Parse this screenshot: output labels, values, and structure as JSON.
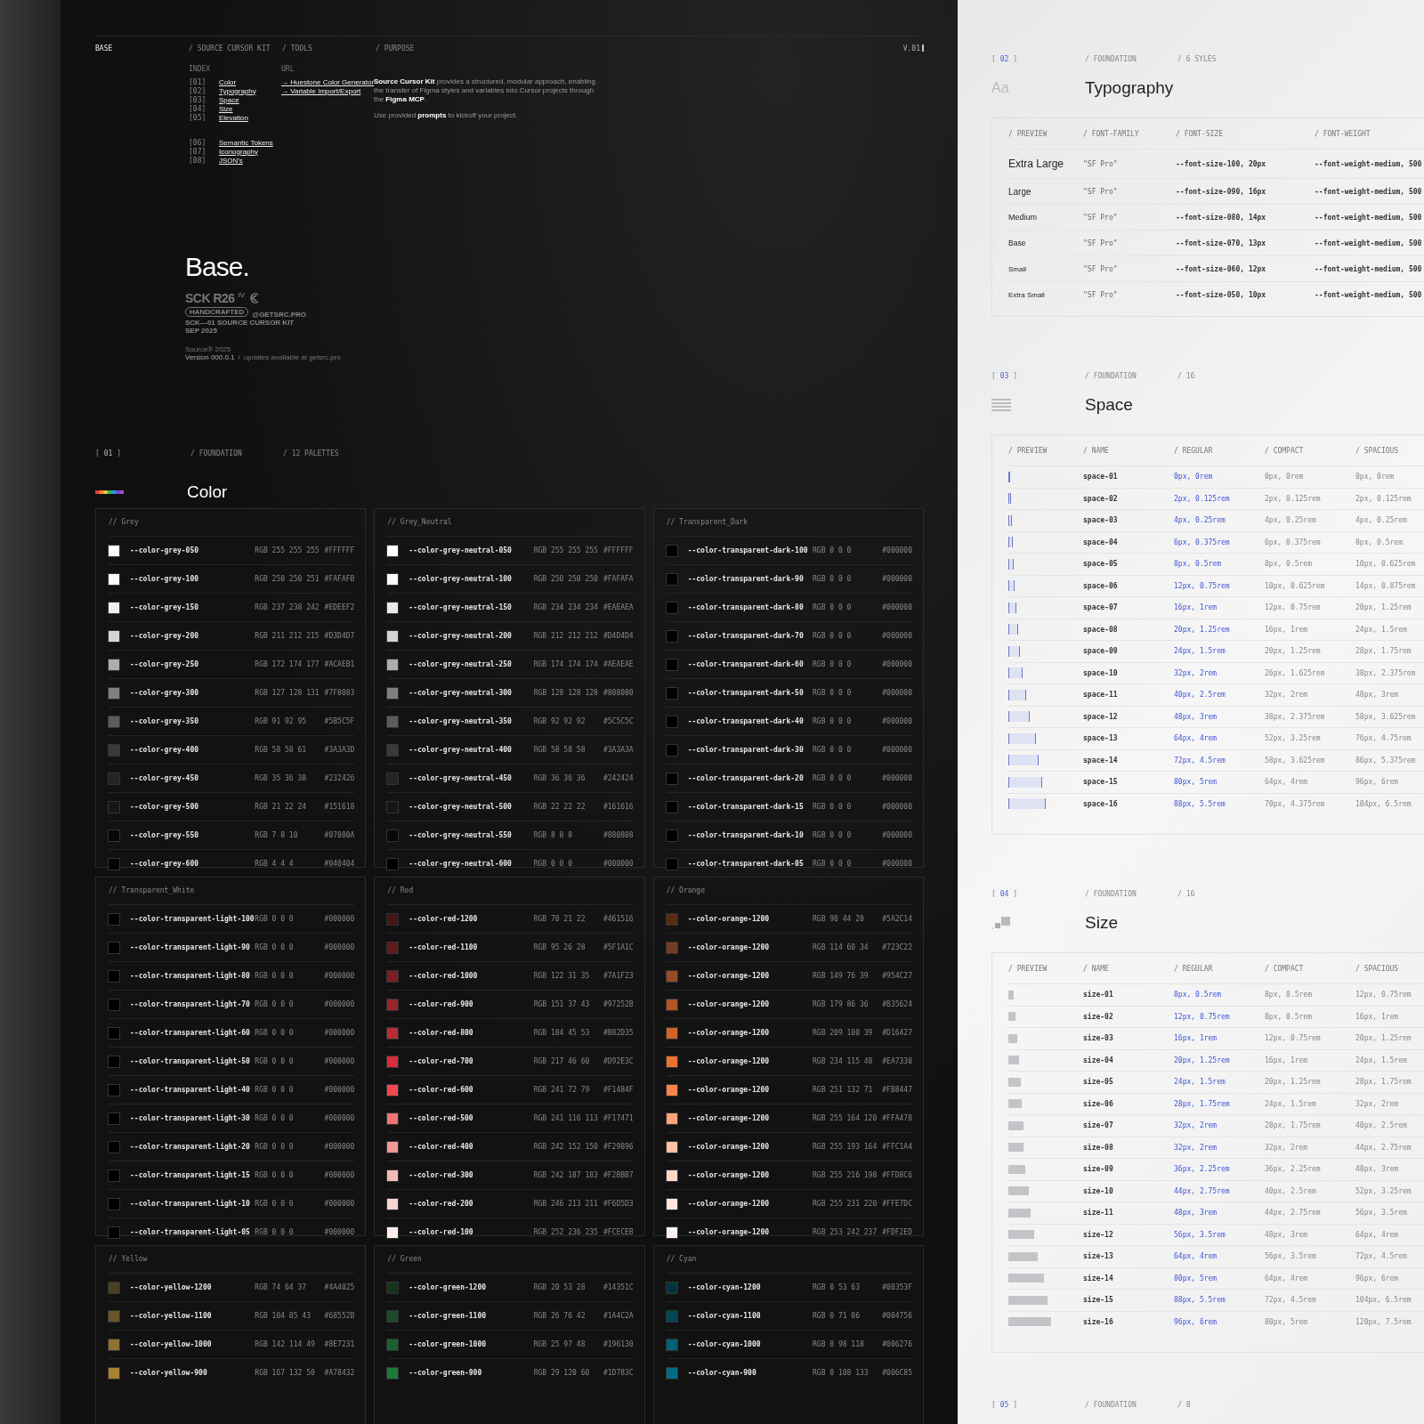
{
  "header": [
    {
      "label": "BASE",
      "selected": true
    },
    {
      "label": "/ SOURCE CURSOR KIT",
      "selected": false
    },
    {
      "label": "/ TOOLS",
      "selected": false
    },
    {
      "label": "/ PURPOSE",
      "selected": false
    }
  ],
  "version": "V.01",
  "index": {
    "label": "INDEX",
    "groups": [
      [
        {
          "num": "[01]",
          "label": "Color"
        },
        {
          "num": "[02]",
          "label": "Typography"
        },
        {
          "num": "[03]",
          "label": "Space"
        },
        {
          "num": "[04]",
          "label": "Size"
        },
        {
          "num": "[05]",
          "label": "Elevation"
        }
      ],
      [
        {
          "num": "[06]",
          "label": "Semantic Tokens"
        },
        {
          "num": "[07]",
          "label": "Iconography"
        },
        {
          "num": "[08]",
          "label": "JSON's"
        }
      ]
    ]
  },
  "tools": {
    "label": "URL",
    "links": [
      "→ Huestone Color Generator",
      "→ Variable Import/Export"
    ]
  },
  "purpose": [
    "**Source Cursor Kit** provides a structured, modular approach, enabling the transfer of Figma styles and variables into Cursor projects through the **Figma MCP**.",
    "Use provided **prompts** to kickoff your project."
  ],
  "hero": {
    "title": "Base.",
    "logo": "SCK R26",
    "logo_mark": "IV",
    "pill": "HANDCRAFTED",
    "handle": "@GETSRC.PRO",
    "kit": "SCK—01 SOURCE CURSOR KIT",
    "date": "SEP 2025",
    "copyright": "Source® 2025",
    "version": "Version 000.0.1",
    "separator": "/",
    "updates": "updates available at getsrc.pro"
  },
  "color_section": {
    "open": "[",
    "number": "01",
    "close": "]",
    "tags": [
      "/ FOUNDATION",
      "/ 12 PALETTES"
    ],
    "title": "Color",
    "palettes": [
      {
        "name": "// Grey",
        "swatches": [
          {
            "name": "--color-grey-050",
            "rgb": "RGB 255 255 255",
            "hex": "#FFFFFF",
            "color": "#ffffff"
          },
          {
            "name": "--color-grey-100",
            "rgb": "RGB 250 250 251",
            "hex": "#FAFAFB",
            "color": "#fafafb"
          },
          {
            "name": "--color-grey-150",
            "rgb": "RGB 237 238 242",
            "hex": "#EDEEF2",
            "color": "#edeef2"
          },
          {
            "name": "--color-grey-200",
            "rgb": "RGB 211 212 215",
            "hex": "#D3D4D7",
            "color": "#d3d4d7"
          },
          {
            "name": "--color-grey-250",
            "rgb": "RGB 172 174 177",
            "hex": "#ACAEB1",
            "color": "#acaeb1"
          },
          {
            "name": "--color-grey-300",
            "rgb": "RGB 127 128 131",
            "hex": "#7F8083",
            "color": "#7f8083"
          },
          {
            "name": "--color-grey-350",
            "rgb": "RGB 91 92 95",
            "hex": "#5B5C5F",
            "color": "#5b5c5f"
          },
          {
            "name": "--color-grey-400",
            "rgb": "RGB 58 58 61",
            "hex": "#3A3A3D",
            "color": "#3a3a3d"
          },
          {
            "name": "--color-grey-450",
            "rgb": "RGB 35 36 38",
            "hex": "#232426",
            "color": "#232426"
          },
          {
            "name": "--color-grey-500",
            "rgb": "RGB 21 22 24",
            "hex": "#151618",
            "color": "#151618"
          },
          {
            "name": "--color-grey-550",
            "rgb": "RGB 7 8 10",
            "hex": "#07080A",
            "color": "#07080a"
          },
          {
            "name": "--color-grey-600",
            "rgb": "RGB 4 4 4",
            "hex": "#040404",
            "color": "#040404"
          }
        ]
      },
      {
        "name": "// Grey_Neutral",
        "swatches": [
          {
            "name": "--color-grey-neutral-050",
            "rgb": "RGB 255 255 255",
            "hex": "#FFFFFF",
            "color": "#ffffff"
          },
          {
            "name": "--color-grey-neutral-100",
            "rgb": "RGB 250 250 250",
            "hex": "#FAFAFA",
            "color": "#fafafa"
          },
          {
            "name": "--color-grey-neutral-150",
            "rgb": "RGB 234 234 234",
            "hex": "#EAEAEA",
            "color": "#eaeaea"
          },
          {
            "name": "--color-grey-neutral-200",
            "rgb": "RGB 212 212 212",
            "hex": "#D4D4D4",
            "color": "#d4d4d4"
          },
          {
            "name": "--color-grey-neutral-250",
            "rgb": "RGB 174 174 174",
            "hex": "#AEAEAE",
            "color": "#aeaeae"
          },
          {
            "name": "--color-grey-neutral-300",
            "rgb": "RGB 128 128 128",
            "hex": "#808080",
            "color": "#808080"
          },
          {
            "name": "--color-grey-neutral-350",
            "rgb": "RGB 92 92 92",
            "hex": "#5C5C5C",
            "color": "#5c5c5c"
          },
          {
            "name": "--color-grey-neutral-400",
            "rgb": "RGB 58 58 58",
            "hex": "#3A3A3A",
            "color": "#3a3a3a"
          },
          {
            "name": "--color-grey-neutral-450",
            "rgb": "RGB 36 36 36",
            "hex": "#242424",
            "color": "#242424"
          },
          {
            "name": "--color-grey-neutral-500",
            "rgb": "RGB 22 22 22",
            "hex": "#161616",
            "color": "#161616"
          },
          {
            "name": "--color-grey-neutral-550",
            "rgb": "RGB 8 8 8",
            "hex": "#080808",
            "color": "#080808"
          },
          {
            "name": "--color-grey-neutral-600",
            "rgb": "RGB 0 0 0",
            "hex": "#000000",
            "color": "#000000"
          }
        ]
      },
      {
        "name": "// Transparent_Dark",
        "swatches": [
          {
            "name": "--color-transparent-dark-100",
            "rgb": "RGB 0 0 0",
            "hex": "#000000",
            "color": "#000000"
          },
          {
            "name": "--color-transparent-dark-90",
            "rgb": "RGB 0 0 0",
            "hex": "#000000",
            "color": "#000000"
          },
          {
            "name": "--color-transparent-dark-80",
            "rgb": "RGB 0 0 0",
            "hex": "#000000",
            "color": "#000000"
          },
          {
            "name": "--color-transparent-dark-70",
            "rgb": "RGB 0 0 0",
            "hex": "#000000",
            "color": "#000000"
          },
          {
            "name": "--color-transparent-dark-60",
            "rgb": "RGB 0 0 0",
            "hex": "#000000",
            "color": "#000000"
          },
          {
            "name": "--color-transparent-dark-50",
            "rgb": "RGB 0 0 0",
            "hex": "#000000",
            "color": "#000000"
          },
          {
            "name": "--color-transparent-dark-40",
            "rgb": "RGB 0 0 0",
            "hex": "#000000",
            "color": "#000000"
          },
          {
            "name": "--color-transparent-dark-30",
            "rgb": "RGB 0 0 0",
            "hex": "#000000",
            "color": "#000000"
          },
          {
            "name": "--color-transparent-dark-20",
            "rgb": "RGB 0 0 0",
            "hex": "#000000",
            "color": "#000000"
          },
          {
            "name": "--color-transparent-dark-15",
            "rgb": "RGB 0 0 0",
            "hex": "#000000",
            "color": "#000000"
          },
          {
            "name": "--color-transparent-dark-10",
            "rgb": "RGB 0 0 0",
            "hex": "#000000",
            "color": "#000000"
          },
          {
            "name": "--color-transparent-dark-05",
            "rgb": "RGB 0 0 0",
            "hex": "#000000",
            "color": "#000000"
          }
        ]
      },
      {
        "name": "// Transparent_White",
        "swatches": [
          {
            "name": "--color-transparent-light-100",
            "rgb": "RGB 0 0 0",
            "hex": "#000000",
            "color": "#000000"
          },
          {
            "name": "--color-transparent-light-90",
            "rgb": "RGB 0 0 0",
            "hex": "#000000",
            "color": "#000000"
          },
          {
            "name": "--color-transparent-light-80",
            "rgb": "RGB 0 0 0",
            "hex": "#000000",
            "color": "#000000"
          },
          {
            "name": "--color-transparent-light-70",
            "rgb": "RGB 0 0 0",
            "hex": "#000000",
            "color": "#000000"
          },
          {
            "name": "--color-transparent-light-60",
            "rgb": "RGB 0 0 0",
            "hex": "#000000",
            "color": "#000000"
          },
          {
            "name": "--color-transparent-light-50",
            "rgb": "RGB 0 0 0",
            "hex": "#000000",
            "color": "#000000"
          },
          {
            "name": "--color-transparent-light-40",
            "rgb": "RGB 0 0 0",
            "hex": "#000000",
            "color": "#000000"
          },
          {
            "name": "--color-transparent-light-30",
            "rgb": "RGB 0 0 0",
            "hex": "#000000",
            "color": "#000000"
          },
          {
            "name": "--color-transparent-light-20",
            "rgb": "RGB 0 0 0",
            "hex": "#000000",
            "color": "#000000"
          },
          {
            "name": "--color-transparent-light-15",
            "rgb": "RGB 0 0 0",
            "hex": "#000000",
            "color": "#000000"
          },
          {
            "name": "--color-transparent-light-10",
            "rgb": "RGB 0 0 0",
            "hex": "#000000",
            "color": "#000000"
          },
          {
            "name": "--color-transparent-light-05",
            "rgb": "RGB 0 0 0",
            "hex": "#000000",
            "color": "#000000"
          }
        ]
      },
      {
        "name": "// Red",
        "swatches": [
          {
            "name": "--color-red-1200",
            "rgb": "RGB 70 21 22",
            "hex": "#461516",
            "color": "#461516"
          },
          {
            "name": "--color-red-1100",
            "rgb": "RGB 95 26 28",
            "hex": "#5F1A1C",
            "color": "#5f1a1c"
          },
          {
            "name": "--color-red-1000",
            "rgb": "RGB 122 31 35",
            "hex": "#7A1F23",
            "color": "#7a1f23"
          },
          {
            "name": "--color-red-900",
            "rgb": "RGB 151 37 43",
            "hex": "#97252B",
            "color": "#97252b"
          },
          {
            "name": "--color-red-800",
            "rgb": "RGB 184 45 53",
            "hex": "#B82D35",
            "color": "#b82d35"
          },
          {
            "name": "--color-red-700",
            "rgb": "RGB 217 46 60",
            "hex": "#D92E3C",
            "color": "#d92e3c"
          },
          {
            "name": "--color-red-600",
            "rgb": "RGB 241 72 79",
            "hex": "#F1484F",
            "color": "#f1484f"
          },
          {
            "name": "--color-red-500",
            "rgb": "RGB 241 116 113",
            "hex": "#F17471",
            "color": "#f17471"
          },
          {
            "name": "--color-red-400",
            "rgb": "RGB 242 152 150",
            "hex": "#F29896",
            "color": "#f29896"
          },
          {
            "name": "--color-red-300",
            "rgb": "RGB 242 187 183",
            "hex": "#F2BBB7",
            "color": "#f2bbb7"
          },
          {
            "name": "--color-red-200",
            "rgb": "RGB 246 213 211",
            "hex": "#F6D5D3",
            "color": "#f6d5d3"
          },
          {
            "name": "--color-red-100",
            "rgb": "RGB 252 236 235",
            "hex": "#FCECEB",
            "color": "#fceceb"
          }
        ]
      },
      {
        "name": "// Orange",
        "swatches": [
          {
            "name": "--color-orange-1200",
            "rgb": "RGB 90 44 20",
            "hex": "#5A2C14",
            "color": "#5a2c14"
          },
          {
            "name": "--color-orange-1200",
            "rgb": "RGB 114 60 34",
            "hex": "#723C22",
            "color": "#723c22"
          },
          {
            "name": "--color-orange-1200",
            "rgb": "RGB 149 76 39",
            "hex": "#954C27",
            "color": "#954c27"
          },
          {
            "name": "--color-orange-1200",
            "rgb": "RGB 179 86 36",
            "hex": "#B35624",
            "color": "#b35624"
          },
          {
            "name": "--color-orange-1200",
            "rgb": "RGB 209 100 39",
            "hex": "#D16427",
            "color": "#d16427"
          },
          {
            "name": "--color-orange-1200",
            "rgb": "RGB 234 115 48",
            "hex": "#EA7330",
            "color": "#ea7330"
          },
          {
            "name": "--color-orange-1200",
            "rgb": "RGB 251 132 71",
            "hex": "#FB8447",
            "color": "#fb8447"
          },
          {
            "name": "--color-orange-1200",
            "rgb": "RGB 255 164 120",
            "hex": "#FFA478",
            "color": "#ffa478"
          },
          {
            "name": "--color-orange-1200",
            "rgb": "RGB 255 193 164",
            "hex": "#FFC1A4",
            "color": "#ffc1a4"
          },
          {
            "name": "--color-orange-1200",
            "rgb": "RGB 255 216 198",
            "hex": "#FFD8C6",
            "color": "#ffd8c6"
          },
          {
            "name": "--color-orange-1200",
            "rgb": "RGB 255 231 220",
            "hex": "#FFE7DC",
            "color": "#ffe7dc"
          },
          {
            "name": "--color-orange-1200",
            "rgb": "RGB 253 242 237",
            "hex": "#FDF2ED",
            "color": "#fdf2ed"
          }
        ]
      },
      {
        "name": "// Yellow",
        "swatches": [
          {
            "name": "--color-yellow-1200",
            "rgb": "RGB 74 64 37",
            "hex": "#4A4025",
            "color": "#4a4025"
          },
          {
            "name": "--color-yellow-1100",
            "rgb": "RGB 104 85 43",
            "hex": "#68552B",
            "color": "#68552b"
          },
          {
            "name": "--color-yellow-1000",
            "rgb": "RGB 142 114 49",
            "hex": "#8E7231",
            "color": "#8e7231"
          },
          {
            "name": "--color-yellow-900",
            "rgb": "RGB 167 132 50",
            "hex": "#A78432",
            "color": "#a78432"
          }
        ]
      },
      {
        "name": "// Green",
        "swatches": [
          {
            "name": "--color-green-1200",
            "rgb": "RGB 20 53 28",
            "hex": "#14351C",
            "color": "#14351c"
          },
          {
            "name": "--color-green-1100",
            "rgb": "RGB 26 76 42",
            "hex": "#1A4C2A",
            "color": "#1a4c2a"
          },
          {
            "name": "--color-green-1000",
            "rgb": "RGB 25 97 48",
            "hex": "#196130",
            "color": "#196130"
          },
          {
            "name": "--color-green-900",
            "rgb": "RGB 29 120 60",
            "hex": "#1D783C",
            "color": "#1d783c"
          }
        ]
      },
      {
        "name": "// Cyan",
        "swatches": [
          {
            "name": "--color-cyan-1200",
            "rgb": "RGB 0 53 63",
            "hex": "#00353F",
            "color": "#00353f"
          },
          {
            "name": "--color-cyan-1100",
            "rgb": "RGB 0 71 86",
            "hex": "#004756",
            "color": "#004756"
          },
          {
            "name": "--color-cyan-1000",
            "rgb": "RGB 0 98 118",
            "hex": "#006276",
            "color": "#006276"
          },
          {
            "name": "--color-cyan-900",
            "rgb": "RGB 0 108 133",
            "hex": "#006C85",
            "color": "#006c85"
          }
        ]
      }
    ]
  },
  "typography": {
    "open": "[",
    "number": "02",
    "close": "]",
    "tags": [
      "/ FOUNDATION",
      "/ 6 SYLES"
    ],
    "icon_text": "Aa",
    "title": "Typography",
    "columns": [
      "/ PREVIEW",
      "/ FONT-FAMILY",
      "/ FONT-SIZE",
      "/ FONT-WEIGHT"
    ],
    "rows": [
      {
        "preview": "Extra Large",
        "family": "\"SF Pro\"",
        "size": "--font-size-100, 20px",
        "weight": "--font-weight-medium, 500"
      },
      {
        "preview": "Large",
        "family": "\"SF Pro\"",
        "size": "--font-size-090, 16px",
        "weight": "--font-weight-medium, 500"
      },
      {
        "preview": "Medium",
        "family": "\"SF Pro\"",
        "size": "--font-size-080, 14px",
        "weight": "--font-weight-medium, 500"
      },
      {
        "preview": "Base",
        "family": "\"SF Pro\"",
        "size": "--font-size-070, 13px",
        "weight": "--font-weight-medium, 500"
      },
      {
        "preview": "Small",
        "family": "\"SF Pro\"",
        "size": "--font-size-060, 12px",
        "weight": "--font-weight-medium, 500"
      },
      {
        "preview": "Extra Small",
        "family": "\"SF Pro\"",
        "size": "--font-size-050, 10px",
        "weight": "--font-weight-medium, 500"
      }
    ]
  },
  "space": {
    "open": "[",
    "number": "03",
    "close": "]",
    "tags": [
      "/ FOUNDATION",
      "/ 16"
    ],
    "title": "Space",
    "columns": [
      "/ PREVIEW",
      "/ NAME",
      "/ REGULAR",
      "/ COMPACT",
      "/ SPACIOUS"
    ],
    "rows": [
      {
        "name": "space-01",
        "regular": "0px, 0rem",
        "compact": "0px, 0rem",
        "spacious": "0px, 0rem"
      },
      {
        "name": "space-02",
        "regular": "2px, 0.125rem",
        "compact": "2px, 0.125rem",
        "spacious": "2px, 0.125rem"
      },
      {
        "name": "space-03",
        "regular": "4px, 0.25rem",
        "compact": "4px, 0.25rem",
        "spacious": "4px, 0.25rem"
      },
      {
        "name": "space-04",
        "regular": "6px, 0.375rem",
        "compact": "6px, 0.375rem",
        "spacious": "8px, 0.5rem"
      },
      {
        "name": "space-05",
        "regular": "8px, 0.5rem",
        "compact": "8px, 0.5rem",
        "spacious": "10px, 0.625rem"
      },
      {
        "name": "space-06",
        "regular": "12px, 0.75rem",
        "compact": "10px, 0.625rem",
        "spacious": "14px, 0.875rem"
      },
      {
        "name": "space-07",
        "regular": "16px, 1rem",
        "compact": "12px, 0.75rem",
        "spacious": "20px, 1.25rem"
      },
      {
        "name": "space-08",
        "regular": "20px, 1.25rem",
        "compact": "16px, 1rem",
        "spacious": "24px, 1.5rem"
      },
      {
        "name": "space-09",
        "regular": "24px, 1.5rem",
        "compact": "20px, 1.25rem",
        "spacious": "28px, 1.75rem"
      },
      {
        "name": "space-10",
        "regular": "32px, 2rem",
        "compact": "26px, 1.625rem",
        "spacious": "38px, 2.375rem"
      },
      {
        "name": "space-11",
        "regular": "40px, 2.5rem",
        "compact": "32px, 2rem",
        "spacious": "48px, 3rem"
      },
      {
        "name": "space-12",
        "regular": "48px, 3rem",
        "compact": "38px, 2.375rem",
        "spacious": "58px, 3.625rem"
      },
      {
        "name": "space-13",
        "regular": "64px, 4rem",
        "compact": "52px, 3.25rem",
        "spacious": "76px, 4.75rem"
      },
      {
        "name": "space-14",
        "regular": "72px, 4.5rem",
        "compact": "58px, 3.625rem",
        "spacious": "86px, 5.375rem"
      },
      {
        "name": "space-15",
        "regular": "80px, 5rem",
        "compact": "64px, 4rem",
        "spacious": "96px, 6rem"
      },
      {
        "name": "space-16",
        "regular": "88px, 5.5rem",
        "compact": "70px, 4.375rem",
        "spacious": "104px, 6.5rem"
      }
    ]
  },
  "size": {
    "open": "[",
    "number": "04",
    "close": "]",
    "tags": [
      "/ FOUNDATION",
      "/ 16"
    ],
    "title": "Size",
    "columns": [
      "/ PREVIEW",
      "/ NAME",
      "/ REGULAR",
      "/ COMPACT",
      "/ SPACIOUS"
    ],
    "rows": [
      {
        "name": "size-01",
        "regular": "8px, 0.5rem",
        "compact": "8px, 0.5rem",
        "spacious": "12px, 0.75rem"
      },
      {
        "name": "size-02",
        "regular": "12px, 0.75rem",
        "compact": "8px, 0.5rem",
        "spacious": "16px, 1rem"
      },
      {
        "name": "size-03",
        "regular": "16px, 1rem",
        "compact": "12px, 0.75rem",
        "spacious": "20px, 1.25rem"
      },
      {
        "name": "size-04",
        "regular": "20px, 1.25rem",
        "compact": "16px, 1rem",
        "spacious": "24px, 1.5rem"
      },
      {
        "name": "size-05",
        "regular": "24px, 1.5rem",
        "compact": "20px, 1.25rem",
        "spacious": "28px, 1.75rem"
      },
      {
        "name": "size-06",
        "regular": "28px, 1.75rem",
        "compact": "24px, 1.5rem",
        "spacious": "32px, 2rem"
      },
      {
        "name": "size-07",
        "regular": "32px, 2rem",
        "compact": "28px, 1.75rem",
        "spacious": "40px, 2.5rem"
      },
      {
        "name": "size-08",
        "regular": "32px, 2rem",
        "compact": "32px, 2rem",
        "spacious": "44px, 2.75rem"
      },
      {
        "name": "size-09",
        "regular": "36px, 2.25rem",
        "compact": "36px, 2.25rem",
        "spacious": "48px, 3rem"
      },
      {
        "name": "size-10",
        "regular": "44px, 2.75rem",
        "compact": "40px, 2.5rem",
        "spacious": "52px, 3.25rem"
      },
      {
        "name": "size-11",
        "regular": "48px, 3rem",
        "compact": "44px, 2.75rem",
        "spacious": "56px, 3.5rem"
      },
      {
        "name": "size-12",
        "regular": "56px, 3.5rem",
        "compact": "48px, 3rem",
        "spacious": "64px, 4rem"
      },
      {
        "name": "size-13",
        "regular": "64px, 4rem",
        "compact": "56px, 3.5rem",
        "spacious": "72px, 4.5rem"
      },
      {
        "name": "size-14",
        "regular": "80px, 5rem",
        "compact": "64px, 4rem",
        "spacious": "96px, 6rem"
      },
      {
        "name": "size-15",
        "regular": "88px, 5.5rem",
        "compact": "72px, 4.5rem",
        "spacious": "104px, 6.5rem"
      },
      {
        "name": "size-16",
        "regular": "96px, 6rem",
        "compact": "80px, 5rem",
        "spacious": "120px, 7.5rem"
      }
    ]
  },
  "next_section": {
    "open": "[",
    "number": "05",
    "close": "]",
    "tags": [
      "/ FOUNDATION",
      "/ 8"
    ]
  }
}
